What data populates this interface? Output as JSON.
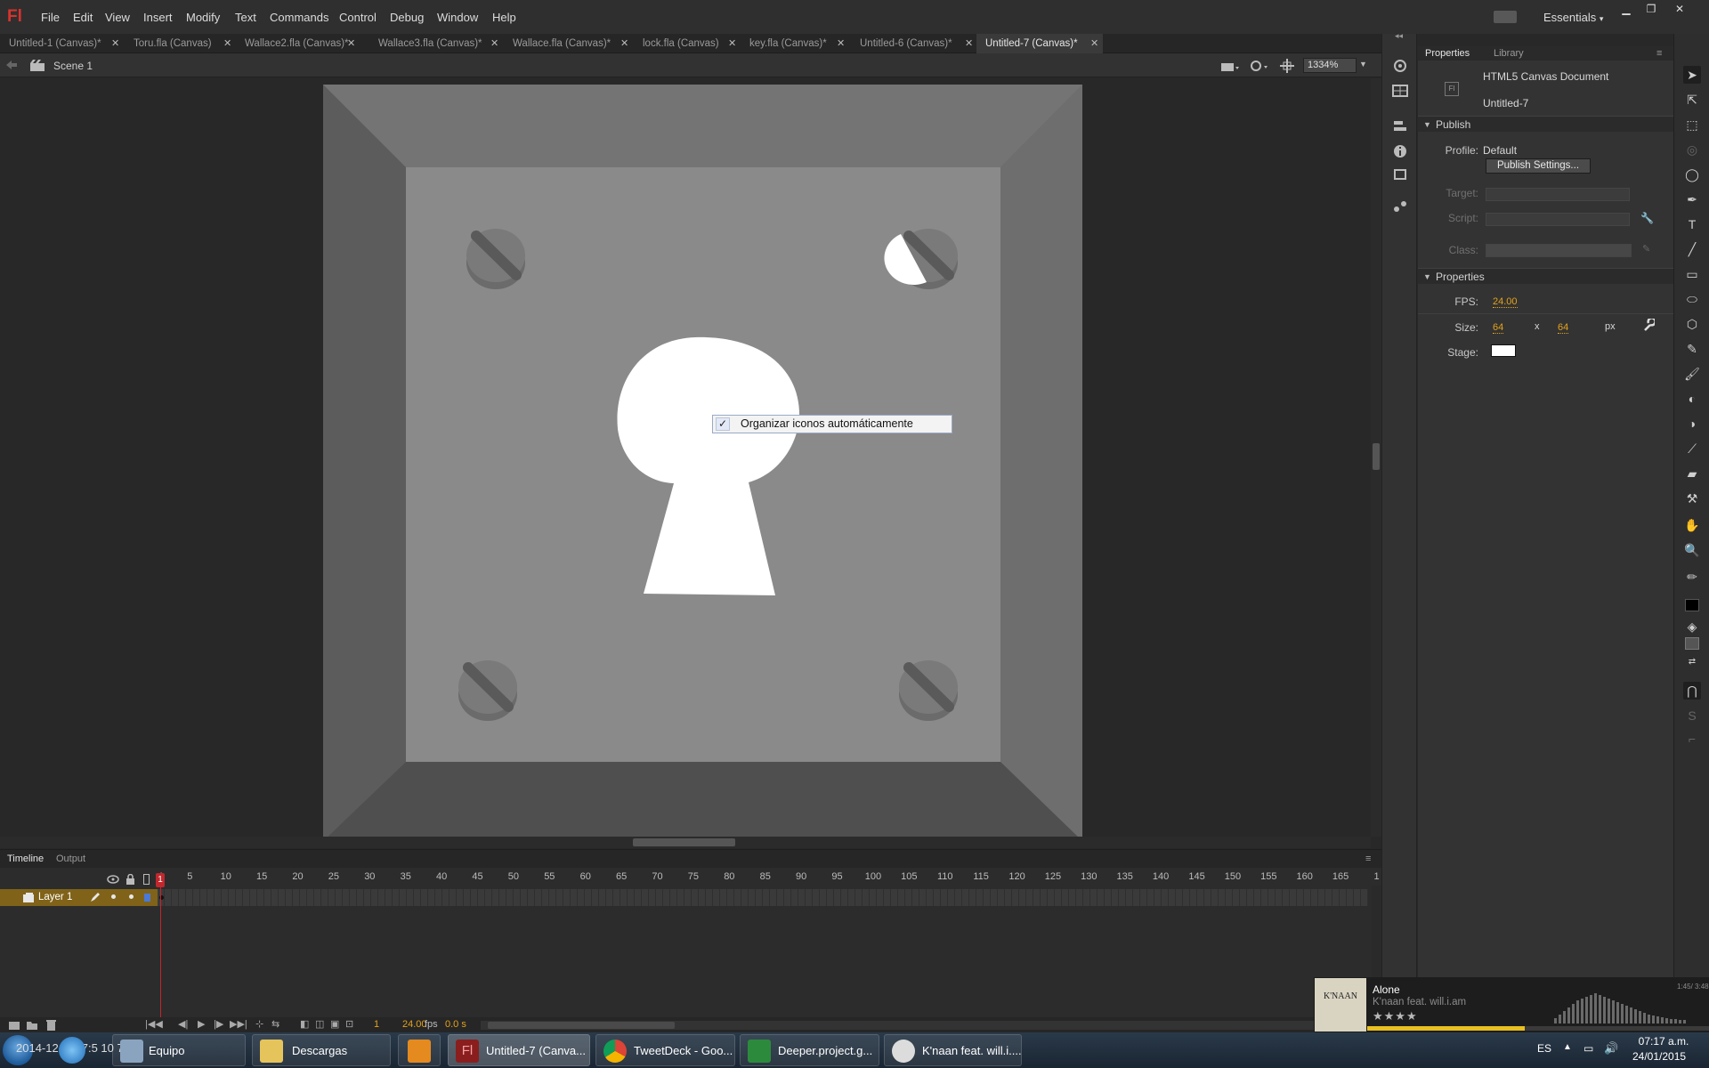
{
  "app": {
    "logo": "Fl",
    "menu": [
      "File",
      "Edit",
      "View",
      "Insert",
      "Modify",
      "Text",
      "Commands",
      "Control",
      "Debug",
      "Window",
      "Help"
    ],
    "workspace": "Essentials"
  },
  "doc_tabs": [
    {
      "label": "Untitled-1 (Canvas)*",
      "active": false
    },
    {
      "label": "Toru.fla (Canvas)",
      "active": false
    },
    {
      "label": "Wallace2.fla (Canvas)*",
      "active": false
    },
    {
      "label": "Wallace3.fla (Canvas)*",
      "active": false
    },
    {
      "label": "Wallace.fla (Canvas)*",
      "active": false
    },
    {
      "label": "lock.fla (Canvas)",
      "active": false
    },
    {
      "label": "key.fla (Canvas)*",
      "active": false
    },
    {
      "label": "Untitled-6 (Canvas)*",
      "active": false
    },
    {
      "label": "Untitled-7 (Canvas)*",
      "active": true
    }
  ],
  "edit_bar": {
    "scene": "Scene 1",
    "zoom": "1334%"
  },
  "context_menu": {
    "check": "✓",
    "label": "Organizar iconos automáticamente"
  },
  "timeline": {
    "tabs": [
      "Timeline",
      "Output"
    ],
    "ticks": [
      "1",
      "5",
      "10",
      "15",
      "20",
      "25",
      "30",
      "35",
      "40",
      "45",
      "50",
      "55",
      "60",
      "65",
      "70",
      "75",
      "80",
      "85",
      "90",
      "95",
      "100",
      "105",
      "110",
      "115",
      "120",
      "125",
      "130",
      "135",
      "140",
      "145",
      "150",
      "155",
      "160",
      "165",
      "1"
    ],
    "layer_name": "Layer 1",
    "current_frame": "1",
    "fps": "24.00",
    "fps_unit": "fps",
    "time": "0.0 s"
  },
  "properties": {
    "tabs": [
      "Properties",
      "Library"
    ],
    "doc_type": "HTML5 Canvas Document",
    "doc_name": "Untitled-7",
    "publish_section": "Publish",
    "profile_label": "Profile:",
    "profile_value": "Default",
    "publish_button": "Publish Settings...",
    "target_label": "Target:",
    "script_label": "Script:",
    "class_label": "Class:",
    "properties_section": "Properties",
    "fps_label": "FPS:",
    "fps_value": "24.00",
    "size_label": "Size:",
    "width": "64",
    "x_sep": "x",
    "height": "64",
    "unit": "px",
    "stage_label": "Stage:",
    "stage_color": "#ffffff"
  },
  "media_player": {
    "album": "K'NAAN",
    "title": "Alone",
    "artist": "K'naan feat. will.i.am",
    "time": "1:45/ 3:48",
    "stars": "★★★★",
    "progress": 0.46
  },
  "taskbar": {
    "overlay_text": "2014-12-2 0 7:5 10 77",
    "items": [
      {
        "label": "Equipo",
        "icon": "computer-icon"
      },
      {
        "label": "Descargas",
        "icon": "folder-icon"
      },
      {
        "label": "",
        "icon": "media-player-icon"
      },
      {
        "label": "Untitled-7 (Canva...",
        "icon": "flash-icon"
      },
      {
        "label": "TweetDeck - Goo...",
        "icon": "chrome-icon"
      },
      {
        "label": "Deeper.project.g...",
        "icon": "project-icon"
      },
      {
        "label": "K'naan feat. will.i....",
        "icon": "music-player-icon"
      }
    ],
    "language": "ES",
    "time": "07:17 a.m.",
    "date": "24/01/2015"
  }
}
